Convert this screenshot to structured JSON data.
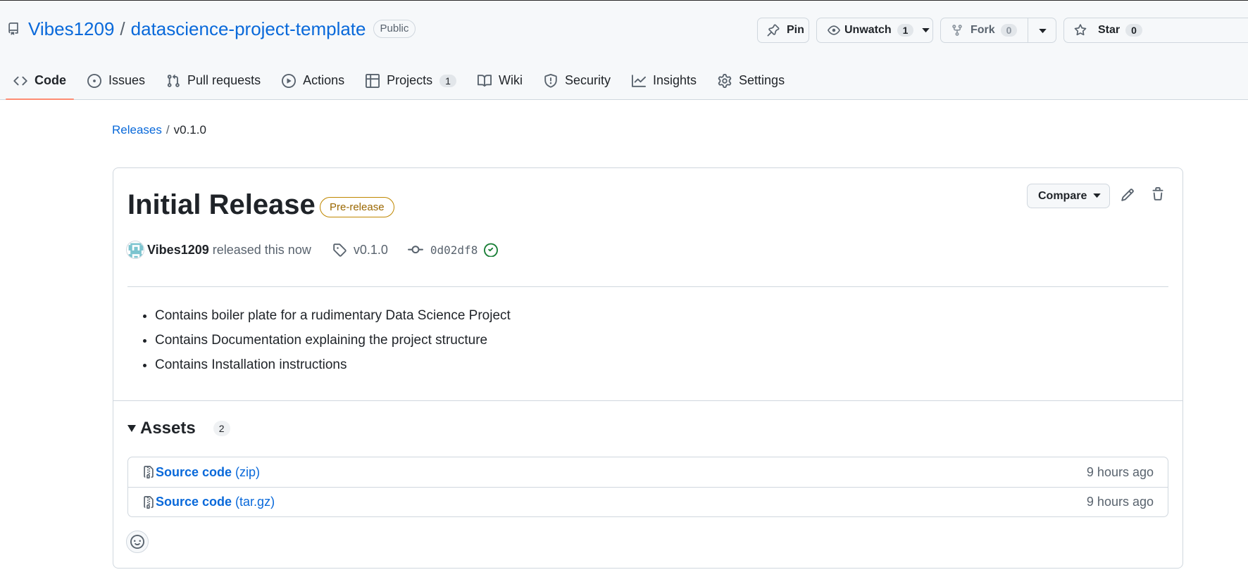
{
  "repo": {
    "owner": "Vibes1209",
    "separator": "/",
    "name": "datascience-project-template",
    "visibility": "Public"
  },
  "actions": {
    "pin_label": "Pin",
    "watch_label": "Unwatch",
    "watch_count": "1",
    "fork_label": "Fork",
    "fork_count": "0",
    "star_label": "Star",
    "star_count": "0"
  },
  "tabs": [
    {
      "label": "Code",
      "icon": "code-icon",
      "selected": true
    },
    {
      "label": "Issues",
      "icon": "issue-icon"
    },
    {
      "label": "Pull requests",
      "icon": "pull-request-icon"
    },
    {
      "label": "Actions",
      "icon": "play-icon"
    },
    {
      "label": "Projects",
      "icon": "table-icon",
      "count": "1"
    },
    {
      "label": "Wiki",
      "icon": "book-icon"
    },
    {
      "label": "Security",
      "icon": "shield-icon"
    },
    {
      "label": "Insights",
      "icon": "graph-icon"
    },
    {
      "label": "Settings",
      "icon": "gear-icon"
    }
  ],
  "breadcrumb": {
    "root": "Releases",
    "separator": "/",
    "current": "v0.1.0"
  },
  "release": {
    "title": "Initial Release",
    "badge": "Pre-release",
    "compare_label": "Compare",
    "author": "Vibes1209",
    "released_text": "released this now",
    "tag": "v0.1.0",
    "commit": "0d02df8",
    "notes": [
      "Contains boiler plate for a rudimentary Data Science Project",
      "Contains Documentation explaining the project structure",
      "Contains Installation instructions"
    ]
  },
  "assets": {
    "title": "Assets",
    "count": "2",
    "items": [
      {
        "name": "Source code",
        "ext": "(zip)",
        "time": "9 hours ago"
      },
      {
        "name": "Source code",
        "ext": "(tar.gz)",
        "time": "9 hours ago"
      }
    ]
  },
  "colors": {
    "link": "#0969da",
    "selected_tab_underline": "#fd8c73",
    "prerelease": "#9a6700",
    "success": "#1a7f37"
  }
}
